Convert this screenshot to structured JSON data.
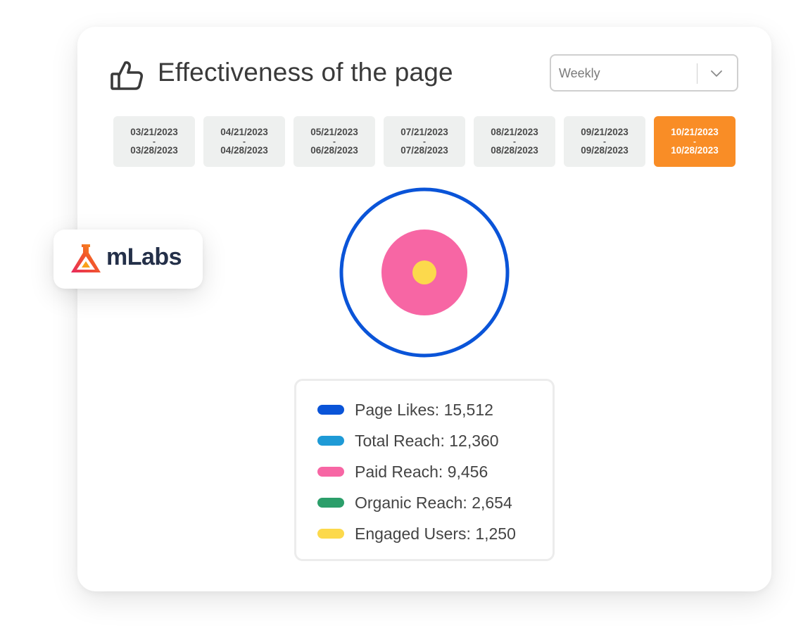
{
  "header": {
    "title": "Effectiveness of the page",
    "icon": "thumbs-up-icon"
  },
  "period_select": {
    "value": "Weekly",
    "icon": "chevron-down-icon"
  },
  "date_ranges": [
    {
      "start": "03/21/2023",
      "sep": "-",
      "end": "03/28/2023",
      "active": false
    },
    {
      "start": "04/21/2023",
      "sep": "-",
      "end": "04/28/2023",
      "active": false
    },
    {
      "start": "05/21/2023",
      "sep": "-",
      "end": "06/28/2023",
      "active": false
    },
    {
      "start": "07/21/2023",
      "sep": "-",
      "end": "07/28/2023",
      "active": false
    },
    {
      "start": "08/21/2023",
      "sep": "-",
      "end": "08/28/2023",
      "active": false
    },
    {
      "start": "09/21/2023",
      "sep": "-",
      "end": "09/28/2023",
      "active": false
    },
    {
      "start": "10/21/2023",
      "sep": "-",
      "end": "10/28/2023",
      "active": true
    }
  ],
  "brand": {
    "name": "mLabs",
    "icon": "mlabs-flask-logo-icon"
  },
  "legend": [
    {
      "text": "Page Likes: 15,512",
      "color": "#0a54d8"
    },
    {
      "text": "Total Reach: 12,360",
      "color": "#1e9ad6"
    },
    {
      "text": "Paid Reach: 9,456",
      "color": "#f766a4"
    },
    {
      "text": "Organic Reach: 2,654",
      "color": "#2b9e6a"
    },
    {
      "text": "Engaged Users: 1,250",
      "color": "#fcd94c"
    }
  ],
  "colors": {
    "accent": "#f98d26",
    "page_likes_ring": "#0a54d8",
    "paid_reach": "#f766a4",
    "engaged_users": "#fcd94c"
  }
}
